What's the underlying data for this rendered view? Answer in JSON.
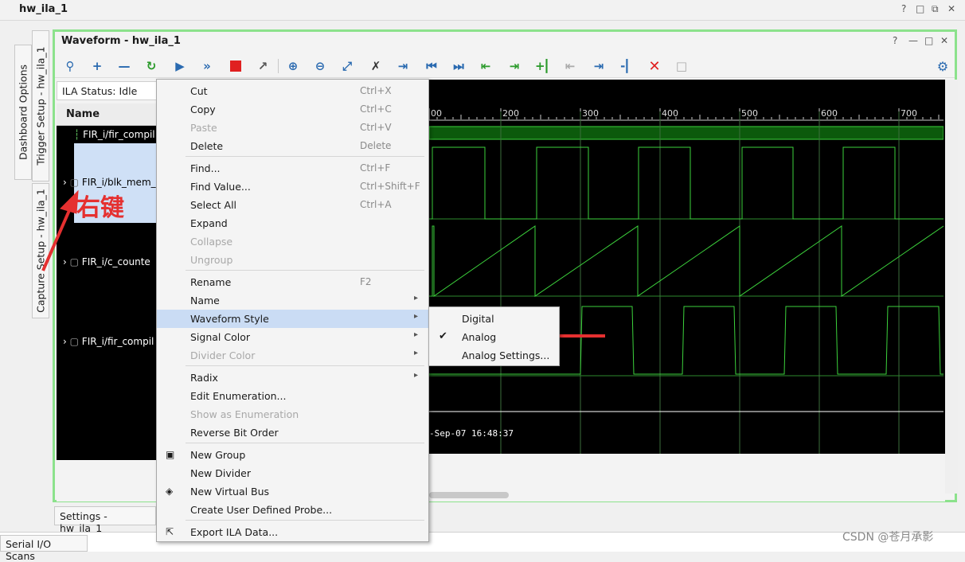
{
  "window": {
    "title": "hw_ila_1",
    "controls": [
      "?",
      "□",
      "⧉",
      "✕"
    ]
  },
  "left_tabs": [
    "Dashboard Options",
    "Trigger Setup - hw_ila_1",
    "Capture Setup - hw_ila_1"
  ],
  "panel": {
    "title": "Waveform - hw_ila_1",
    "controls": [
      "?",
      "—",
      "□",
      "✕"
    ]
  },
  "ila_status": "ILA Status:  Idle",
  "name_header": "Name",
  "signals": [
    "FIR_i/fir_compil",
    "FIR_i/blk_mem_",
    "FIR_i/c_counte",
    "FIR_i/fir_compil"
  ],
  "annotation": "右键",
  "ruler": {
    "ticks": [
      "00",
      "200",
      "300",
      "400",
      "500",
      "600",
      "700"
    ]
  },
  "timestamp": "-Sep-07 16:48:37",
  "context_menu": [
    {
      "label": "Cut",
      "shortcut": "Ctrl+X",
      "enabled": true
    },
    {
      "label": "Copy",
      "shortcut": "Ctrl+C",
      "enabled": true
    },
    {
      "label": "Paste",
      "shortcut": "Ctrl+V",
      "enabled": false
    },
    {
      "label": "Delete",
      "shortcut": "Delete",
      "enabled": true
    },
    {
      "label": "Find...",
      "shortcut": "Ctrl+F",
      "enabled": true
    },
    {
      "label": "Find Value...",
      "shortcut": "Ctrl+Shift+F",
      "enabled": true
    },
    {
      "label": "Select All",
      "shortcut": "Ctrl+A",
      "enabled": true
    },
    {
      "label": "Expand",
      "shortcut": "",
      "enabled": true
    },
    {
      "label": "Collapse",
      "shortcut": "",
      "enabled": false
    },
    {
      "label": "Ungroup",
      "shortcut": "",
      "enabled": false
    },
    {
      "label": "Rename",
      "shortcut": "F2",
      "enabled": true
    },
    {
      "label": "Name",
      "shortcut": "",
      "enabled": true
    },
    {
      "label": "Waveform Style",
      "shortcut": "",
      "enabled": true
    },
    {
      "label": "Signal Color",
      "shortcut": "",
      "enabled": true
    },
    {
      "label": "Divider Color",
      "shortcut": "",
      "enabled": false
    },
    {
      "label": "Radix",
      "shortcut": "",
      "enabled": true
    },
    {
      "label": "Edit Enumeration...",
      "shortcut": "",
      "enabled": true
    },
    {
      "label": "Show as Enumeration",
      "shortcut": "",
      "enabled": false
    },
    {
      "label": "Reverse Bit Order",
      "shortcut": "",
      "enabled": true
    },
    {
      "label": "New Group",
      "shortcut": "",
      "enabled": true
    },
    {
      "label": "New Divider",
      "shortcut": "",
      "enabled": true
    },
    {
      "label": "New Virtual Bus",
      "shortcut": "",
      "enabled": true
    },
    {
      "label": "Create User Defined Probe...",
      "shortcut": "",
      "enabled": true
    },
    {
      "label": "Export ILA Data...",
      "shortcut": "",
      "enabled": true
    }
  ],
  "submenu": [
    {
      "label": "Digital",
      "checked": false
    },
    {
      "label": "Analog",
      "checked": true
    },
    {
      "label": "Analog Settings...",
      "checked": false
    }
  ],
  "settings_tab": "Settings - hw_ila_1",
  "serial_tab": "Serial I/O Scans",
  "watermark": "CSDN @苍月承影",
  "colors": {
    "wave": "#3cd23c",
    "panel_border": "#8ce28c",
    "highlight": "#cadcf4",
    "annotation": "#e53030"
  }
}
